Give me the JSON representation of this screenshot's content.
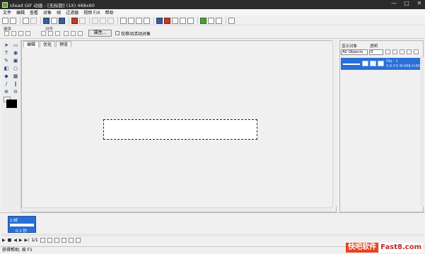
{
  "title_bar": {
    "title": "Ulead GIF 动画 - [无标题] (1X) 468x60",
    "minimize": "—",
    "maximize": "□",
    "close": "✕"
  },
  "menu": [
    "文件",
    "编辑",
    "查看",
    "对象",
    "帧",
    "过滤器",
    "视频 F/X",
    "帮助"
  ],
  "toolbar2": {
    "order_label": "顺序",
    "align_label": "对齐",
    "properties_button": "属性...",
    "move_together_label": "仅移动活动对象"
  },
  "document_tabs": [
    {
      "label": "编辑",
      "active": true
    },
    {
      "label": "优化",
      "active": false
    },
    {
      "label": "预览",
      "active": false
    }
  ],
  "object_panel": {
    "show_objects_label": "显示对象",
    "opacity_label": "透明",
    "object_filter_value": "All Objects",
    "opacity_value": "0",
    "object_name": "Obj - 1",
    "object_info": "X:0,Y:0 W:468,H:60"
  },
  "frames": {
    "frame_label": "1:帧",
    "frame_delay": "0.1 秒",
    "frame_counter": "1/1"
  },
  "status_bar": {
    "text": "获得帮助, 按 F1"
  },
  "watermark": {
    "chinese": "快吧软件",
    "domain": "Fast8.com"
  }
}
